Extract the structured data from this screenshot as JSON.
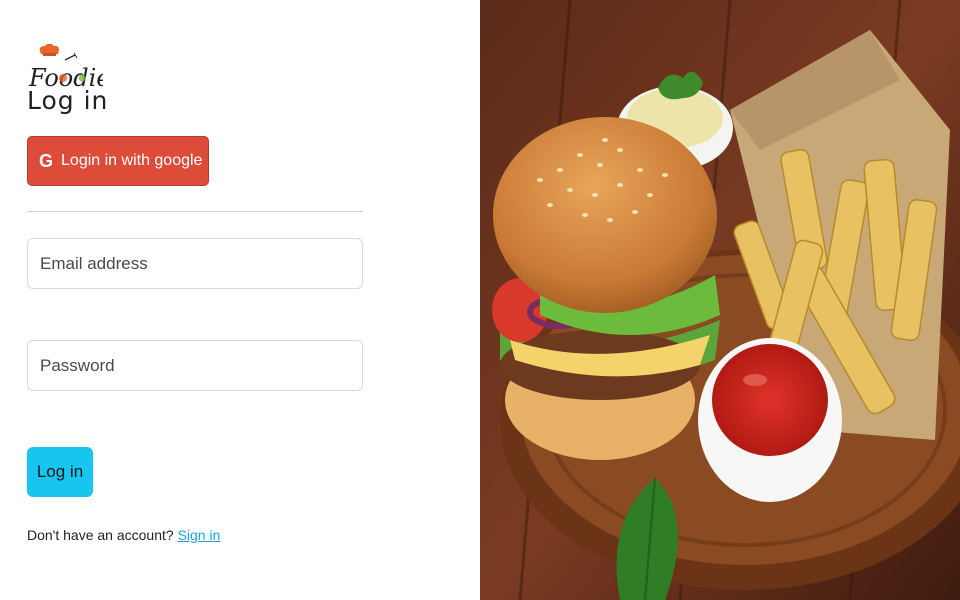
{
  "brand": {
    "logo_text": "Foodie"
  },
  "login": {
    "title": "Log in",
    "google_button": "Login in with google",
    "email_placeholder": "Email address",
    "password_placeholder": "Password",
    "submit": "Log in",
    "signup_prompt": "Don't have an account?",
    "signup_link": "Sign in"
  },
  "colors": {
    "google": "#dd4b39",
    "submit": "#17c5ee",
    "link": "#1aa7d8"
  },
  "image": {
    "subject": "burger-with-fries-and-ketchup"
  }
}
